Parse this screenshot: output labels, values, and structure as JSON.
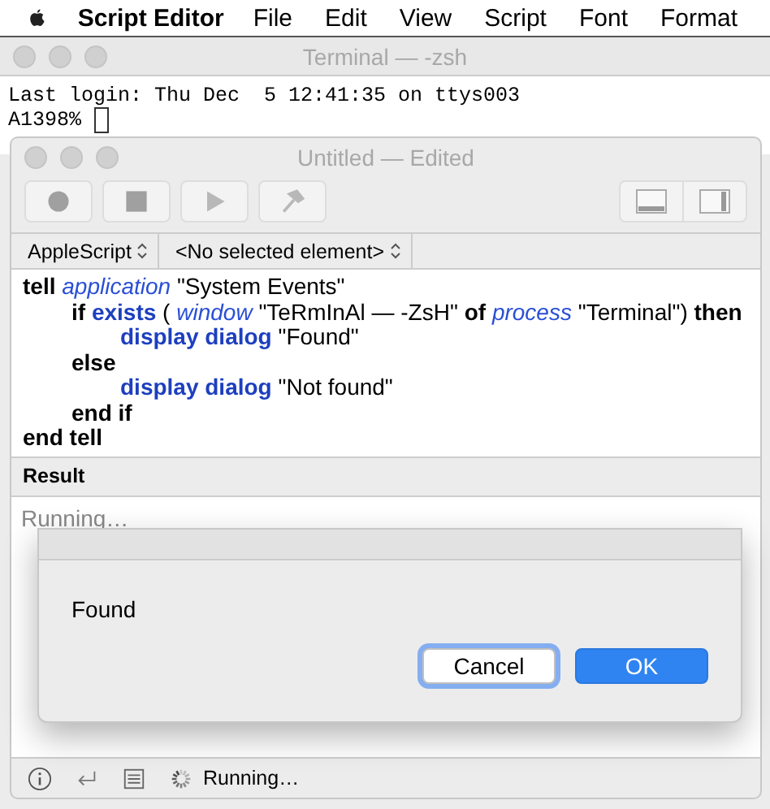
{
  "menu_bar": {
    "app": "Script Editor",
    "items": [
      "File",
      "Edit",
      "View",
      "Script",
      "Font",
      "Format"
    ]
  },
  "terminal": {
    "title": "Terminal — -zsh",
    "lines": [
      "Last login: Thu Dec  5 12:41:35 on ttys003",
      "A1398% "
    ]
  },
  "editor": {
    "title": "Untitled — Edited",
    "toolbar": [
      {
        "kind": "record"
      },
      {
        "kind": "stop"
      },
      {
        "kind": "run"
      },
      {
        "kind": "compile"
      }
    ],
    "view_toggles": [
      {
        "kind": "bottom",
        "selected": false
      },
      {
        "kind": "side",
        "selected": false
      }
    ],
    "language": "AppleScript",
    "element": "<No selected element>",
    "code": [
      {
        "tokens": [
          {
            "kind": "keyword",
            "text": "tell"
          },
          {
            "kind": "class",
            "text": "application"
          },
          {
            "kind": "plain",
            "text": "\"System Events\""
          }
        ],
        "children": [
          {
            "tokens": [
              {
                "kind": "keyword",
                "text": "if"
              },
              {
                "kind": "command",
                "text": "exists"
              },
              {
                "kind": "plain",
                "text": "("
              },
              {
                "kind": "class",
                "text": "window"
              },
              {
                "kind": "plain",
                "text": "\"TeRmInAl — -ZsH\""
              },
              {
                "kind": "keyword",
                "text": "of"
              },
              {
                "kind": "class",
                "text": "process"
              },
              {
                "kind": "plain",
                "text": "\"Terminal\")"
              },
              {
                "kind": "keyword",
                "text": "then"
              }
            ],
            "children": [
              {
                "tokens": [
                  {
                    "kind": "command",
                    "text": "display dialog"
                  },
                  {
                    "kind": "plain",
                    "text": "\"Found\""
                  }
                ]
              }
            ]
          },
          {
            "tokens": [
              {
                "kind": "keyword",
                "text": "else"
              }
            ],
            "children": [
              {
                "tokens": [
                  {
                    "kind": "command",
                    "text": "display dialog"
                  },
                  {
                    "kind": "plain",
                    "text": "\"Not found\""
                  }
                ]
              }
            ]
          },
          {
            "tokens": [
              {
                "kind": "keyword",
                "text": "end if"
              }
            ]
          }
        ]
      },
      {
        "tokens": [
          {
            "kind": "keyword",
            "text": "end tell"
          }
        ]
      }
    ],
    "result_header": "Result",
    "result_text": "Running…",
    "status": "Running…"
  },
  "dialog": {
    "message": "Found",
    "buttons": [
      {
        "label": "Cancel",
        "kind": "normal",
        "focused": true
      },
      {
        "label": "OK",
        "kind": "default",
        "focused": false
      }
    ]
  }
}
